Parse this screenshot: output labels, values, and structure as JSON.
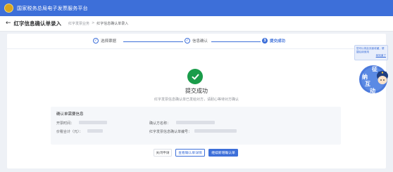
{
  "header": {
    "platform_title": "国家税务总局电子发票服务平台"
  },
  "nav": {
    "page_title": "红字信息确认单录入",
    "breadcrumb": [
      "红字发票业务",
      ">",
      "红字信息确认单录入"
    ]
  },
  "steps": [
    {
      "number": "1",
      "label": "选择票据",
      "status": "done"
    },
    {
      "number": "2",
      "label": "信息确认",
      "status": "done"
    },
    {
      "number": "3",
      "label": "提交成功",
      "status": "active"
    }
  ],
  "result": {
    "title": "提交成功",
    "description": "红字发票信息确认单已发给对方，请耐心等待对方确认"
  },
  "info": {
    "section_title": "确认单需要信息",
    "fields": [
      {
        "label": "开票时间："
      },
      {
        "label": "确认方名称："
      },
      {
        "label": "价税合计（元）："
      },
      {
        "label": "红字发票信息确认单编号："
      }
    ]
  },
  "actions": {
    "close": "关闭申请",
    "view": "查看确认单详情",
    "continue": "继续新增确认单"
  },
  "side_widget": {
    "text": "您可以将此页面收藏，便捷后续使用",
    "link": "我知道了",
    "mascot_text": [
      "征",
      "纳",
      "互",
      "动"
    ]
  },
  "colors": {
    "primary": "#3d6fd9",
    "success": "#1a9c4a"
  }
}
